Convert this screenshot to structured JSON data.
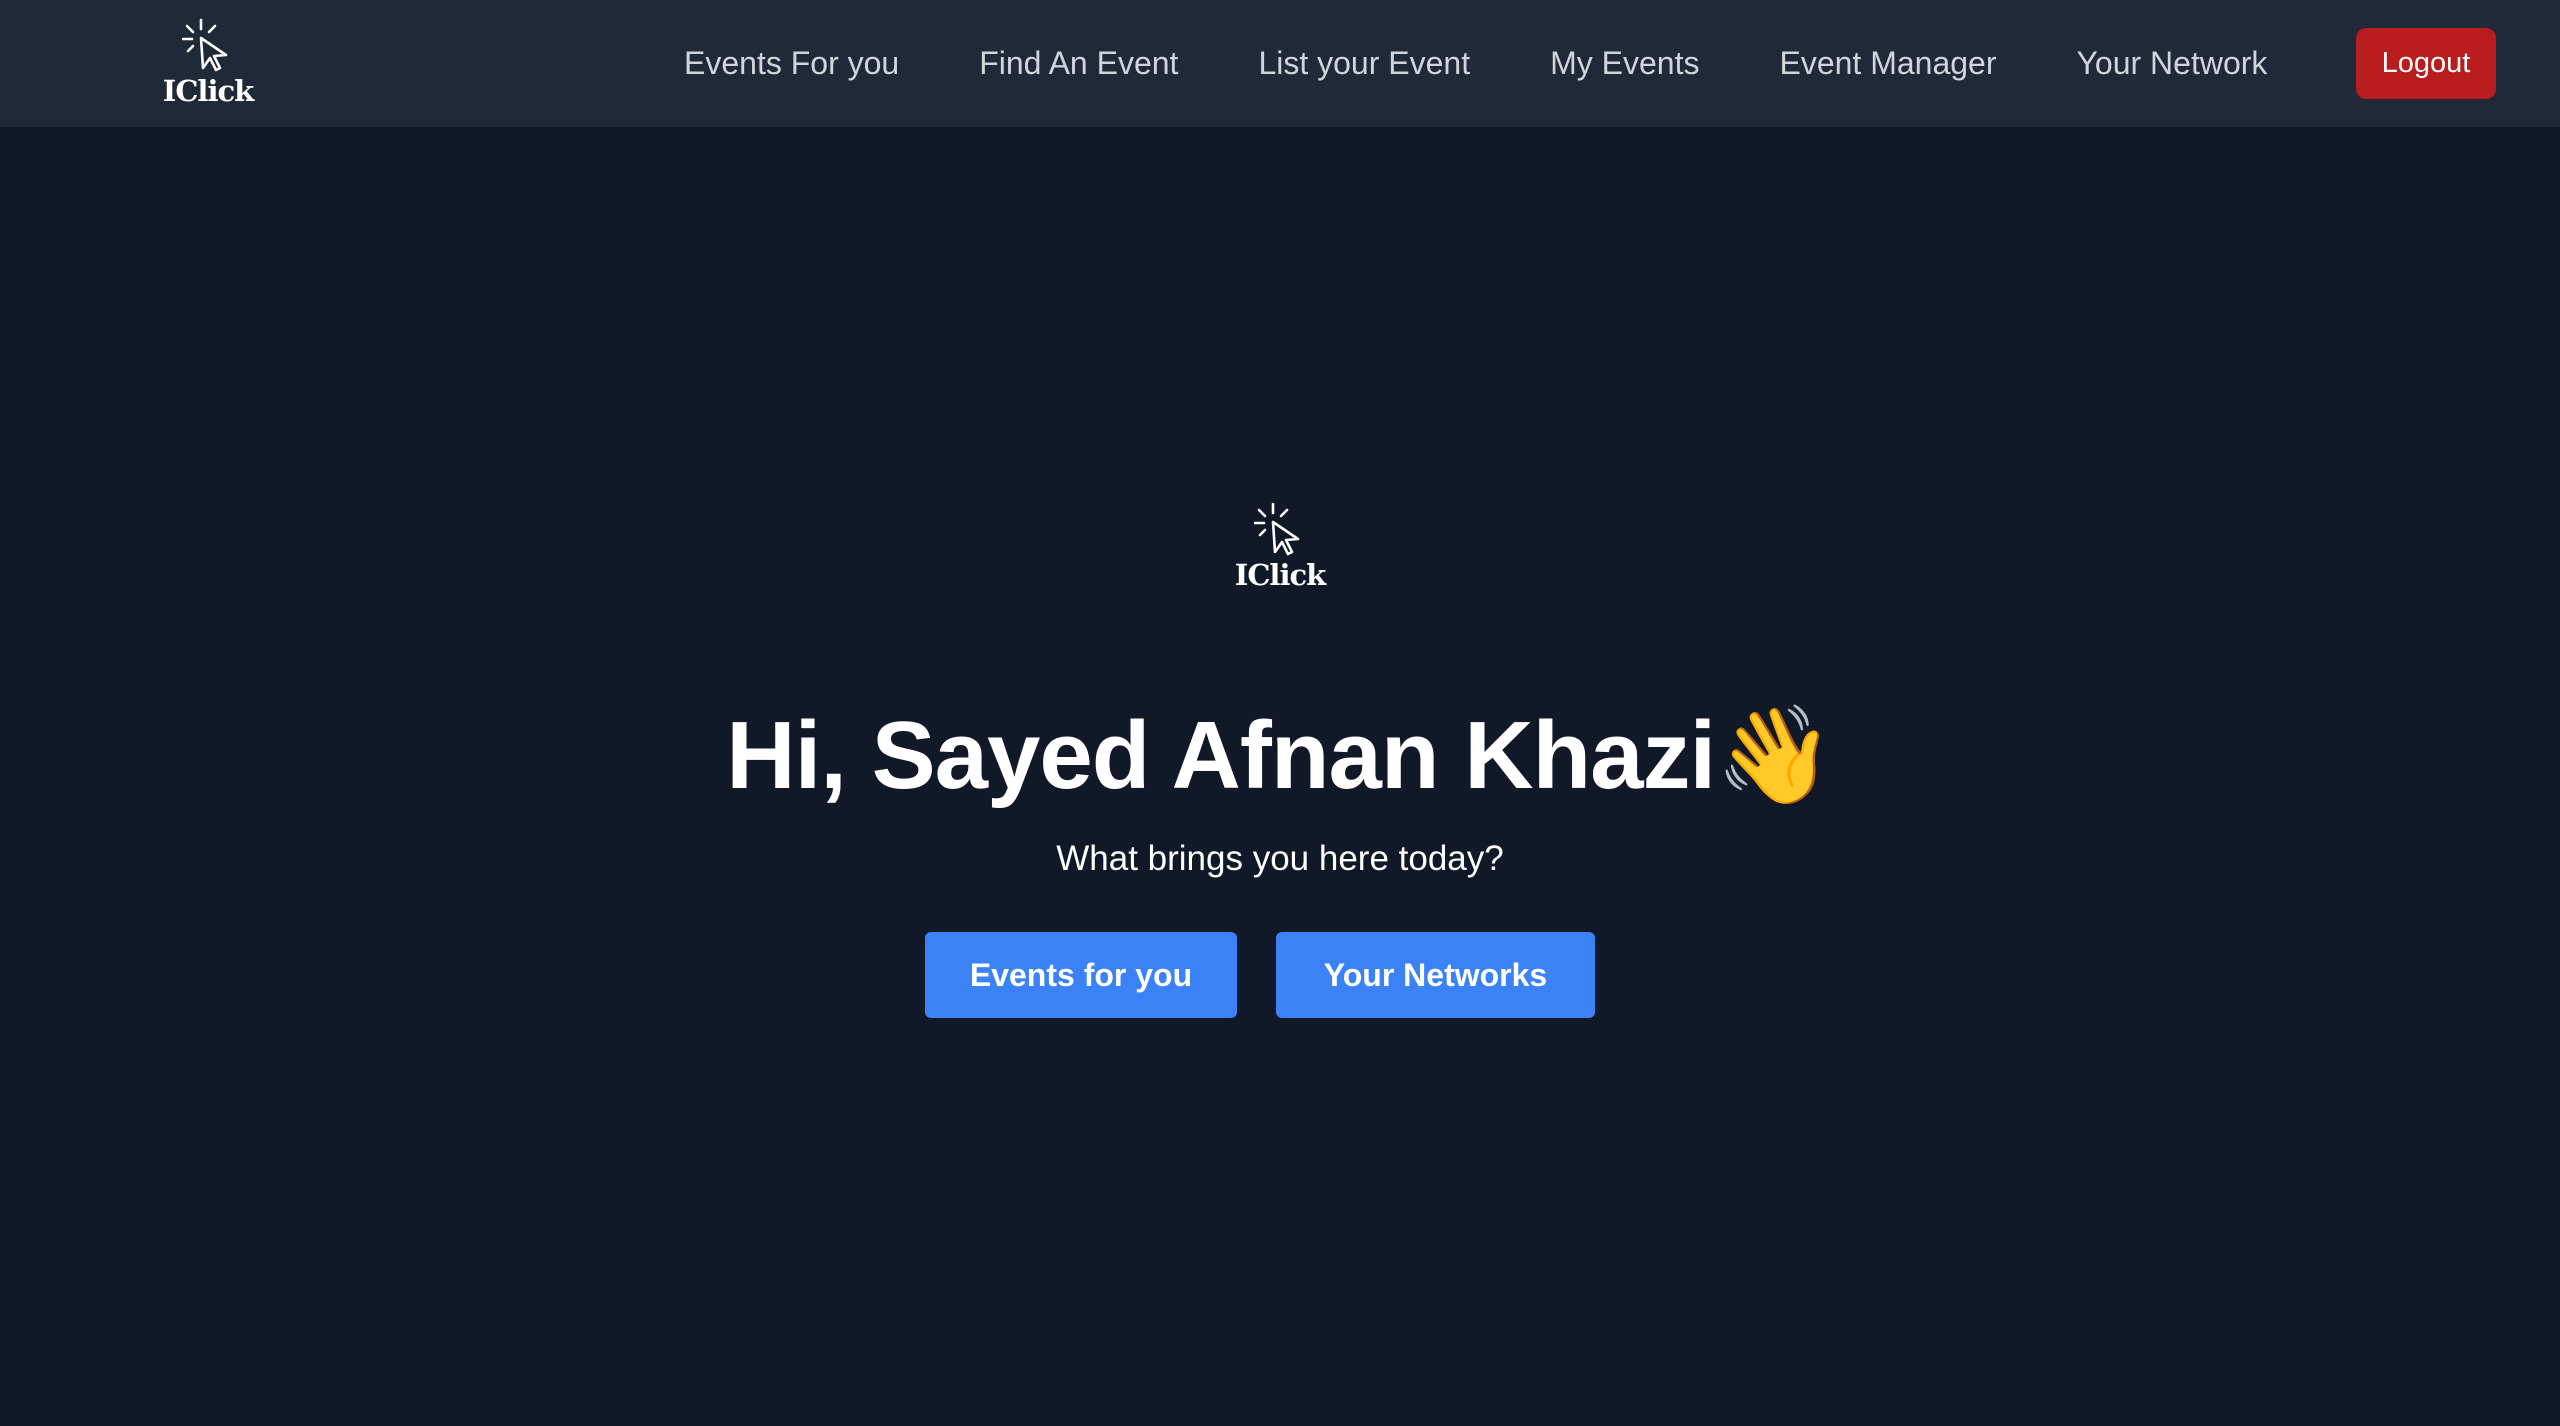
{
  "brand": {
    "name": "IClick",
    "icon": "cursor-click-icon"
  },
  "nav": {
    "items": [
      {
        "label": "Events For you"
      },
      {
        "label": "Find An Event"
      },
      {
        "label": "List your Event"
      },
      {
        "label": "My Events"
      },
      {
        "label": "Event Manager"
      },
      {
        "label": "Your Network"
      }
    ],
    "logout_label": "Logout"
  },
  "hero": {
    "greeting": "Hi, Sayed Afnan Khazi",
    "wave_emoji": "👋",
    "subtitle": "What brings you here today?",
    "primary_button": "Events for you",
    "secondary_button": "Your Networks"
  },
  "colors": {
    "page_bg": "#111827",
    "navbar_bg": "#1f2937",
    "nav_text": "#d1d5db",
    "logout_bg": "#b91c1c",
    "button_bg": "#3b82f6"
  }
}
